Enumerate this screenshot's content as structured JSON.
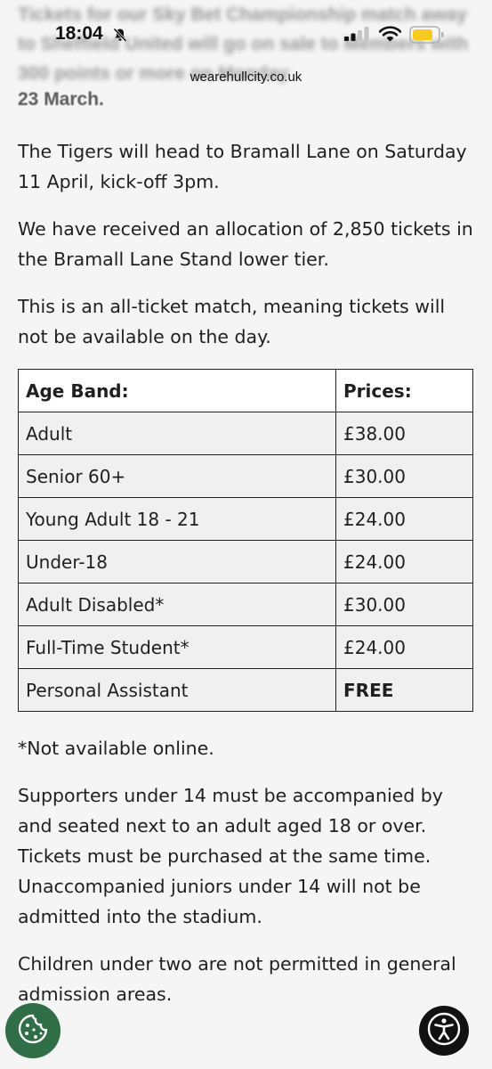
{
  "status_bar": {
    "time": "18:04",
    "battery_color": "#f5cc1d"
  },
  "browser": {
    "url": "wearehullcity.co.uk"
  },
  "article": {
    "blurred_intro": "Tickets for our Sky Bet Championship match away to Sheffield United will go on sale to Members with 300 points or more on Monday",
    "intro_end": "23 March.",
    "paragraphs": [
      "The Tigers will head to Bramall Lane on Saturday 11 April, kick-off 3pm.",
      "We have received an allocation of 2,850 tickets in the Bramall Lane Stand lower tier.",
      "This is an all-ticket match, meaning tickets will not be available on the day."
    ],
    "table": {
      "headers": [
        "Age Band:",
        "Prices:"
      ],
      "rows": [
        [
          "Adult",
          "£38.00"
        ],
        [
          "Senior 60+",
          "£30.00"
        ],
        [
          "Young Adult 18 - 21",
          "£24.00"
        ],
        [
          "Under-18",
          "£24.00"
        ],
        [
          "Adult Disabled*",
          "£30.00"
        ],
        [
          "Full-Time Student*",
          "£24.00"
        ],
        [
          "Personal Assistant",
          "FREE"
        ]
      ]
    },
    "footnote": "*Not available online.",
    "supporters_note": "Supporters under 14 must be accompanied by and seated next to an adult aged 18 or over. Tickets must be purchased at the same time. Unaccompanied juniors under 14 will not be admitted into the stadium.",
    "children_note": "Children under two are not permitted in general admission areas."
  },
  "floating": {
    "cookie_icon": "cookie-icon",
    "accessibility_icon": "accessibility-icon",
    "cookie_color": "#2f6e47"
  }
}
